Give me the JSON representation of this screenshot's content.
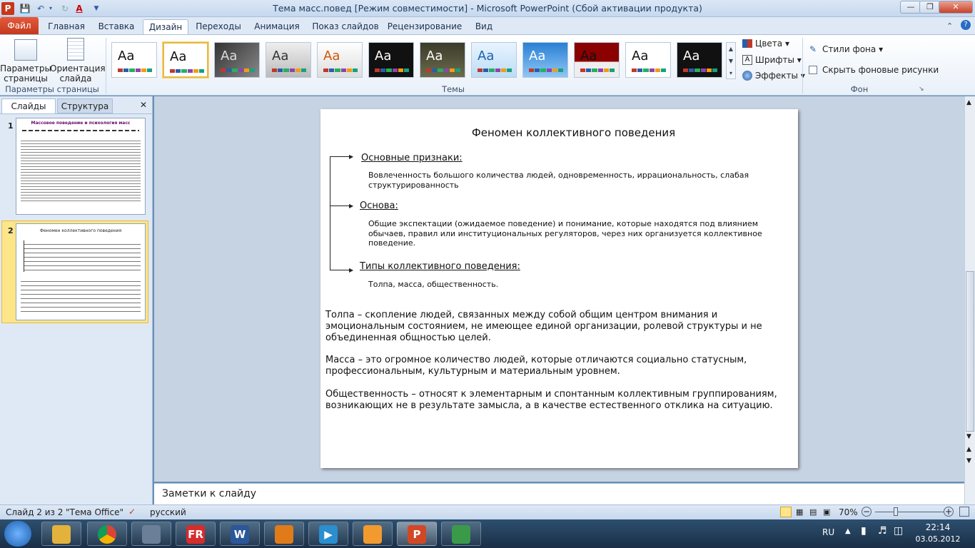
{
  "titlebar": {
    "title": "Тема масс.повед [Режим совместимости] - Microsoft PowerPoint (Сбой активации продукта)"
  },
  "ribbon_tabs": {
    "file": "Файл",
    "tabs": [
      "Главная",
      "Вставка",
      "Дизайн",
      "Переходы",
      "Анимация",
      "Показ слайдов",
      "Рецензирование",
      "Вид"
    ],
    "active": "Дизайн"
  },
  "page_setup": {
    "params": "Параметры страницы",
    "orientation": "Ориентация слайда",
    "group_label": "Параметры страницы"
  },
  "themes": {
    "group_label": "Темы",
    "thumb_text": "Aa",
    "items": [
      "theme-1",
      "theme-2",
      "theme-3",
      "theme-4",
      "theme-5",
      "theme-6",
      "theme-7",
      "theme-8",
      "theme-9",
      "theme-10",
      "theme-11",
      "theme-12"
    ]
  },
  "theme_options": {
    "colors": "Цвета",
    "fonts": "Шрифты",
    "effects": "Эффекты"
  },
  "background": {
    "styles": "Стили фона",
    "hide": "Скрыть фоновые рисунки",
    "group_label": "Фон"
  },
  "left_pane": {
    "tab_slides": "Слайды",
    "tab_outline": "Структура",
    "slide_numbers": [
      "1",
      "2"
    ],
    "thumb1_title": "Массовое поведение и психология масс",
    "thumb2_title": "Феномен коллективного поведения"
  },
  "slide": {
    "title": "Феномен коллективного поведения",
    "h1": "Основные признаки:",
    "p1": "Вовлеченность большого количества людей, одновременность, иррациональность, слабая структурированность",
    "h2": "Основа:",
    "p2": "Общие экспектации (ожидаемое поведение) и понимание, которые находятся под влиянием обычаев, правил или институциональных регуляторов, через них организуется коллективное поведение.",
    "h3": "Типы коллективного поведения:",
    "p3": "Толпа, масса, общественность.",
    "b1": "Толпа – скопление людей, связанных между собой общим центром внимания и эмоциональным состоянием, не имеющее единой организации, ролевой структуры и не объединенная общностью целей.",
    "b2": "Масса – это огромное количество людей, которые отличаются социально статусным, профессиональным, культурным и материальным уровнем.",
    "b3": "Общественность – относят к элементарным и спонтанным коллективным группированиям, возникающих не в результате замысла, а в качестве естественного отклика на ситуацию."
  },
  "notes": {
    "placeholder": "Заметки к слайду"
  },
  "status": {
    "slide_info": "Слайд 2 из 2",
    "theme": "\"Тема Office\"",
    "language": "русский",
    "zoom": "70%"
  },
  "taskbar": {
    "lang": "RU",
    "time": "22:14",
    "date": "03.05.2012"
  }
}
